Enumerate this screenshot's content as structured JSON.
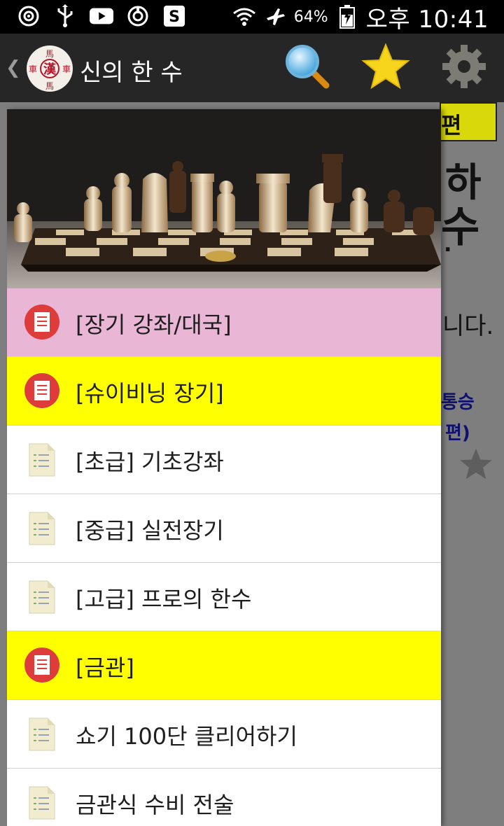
{
  "status_bar": {
    "battery": "64%",
    "time": "오후 10:41",
    "icons": [
      "target-icon",
      "usb-icon",
      "youtube-icon",
      "refresh-icon",
      "s-app-icon",
      "wifi-icon",
      "airplane-icon",
      "battery-icon"
    ]
  },
  "action_bar": {
    "title": "신의 한 수",
    "icons": [
      "back-chevron-icon",
      "app-logo",
      "search-icon",
      "star-icon",
      "gear-icon"
    ]
  },
  "background": {
    "fragment_top": "편",
    "fragment_big1": "하",
    "fragment_big2": "수",
    "fragment_dot": ".",
    "fragment_text": "니다.",
    "fragment_blue1": "통승",
    "fragment_blue2": "편)"
  },
  "drawer": {
    "header_image": "chess-board-photo",
    "items": [
      {
        "label": "[장기 강좌/대국]",
        "style": "pink",
        "icon": "red-document-icon"
      },
      {
        "label": "[슈이비닝 장기]",
        "style": "yellow",
        "icon": "red-document-icon"
      },
      {
        "label": "[초급] 기초강좌",
        "style": "white",
        "icon": "document-icon"
      },
      {
        "label": "[중급] 실전장기",
        "style": "white",
        "icon": "document-icon"
      },
      {
        "label": "[고급] 프로의 한수",
        "style": "white",
        "icon": "document-icon"
      },
      {
        "label": "[금관]",
        "style": "yellow",
        "icon": "red-document-icon"
      },
      {
        "label": "쇼기 100단 클리어하기",
        "style": "white",
        "icon": "document-icon"
      },
      {
        "label": "금관식 수비 전술",
        "style": "white",
        "icon": "document-icon"
      }
    ]
  },
  "colors": {
    "pink": "#eab6d6",
    "yellow": "#ffff00",
    "action_bar": "#262626",
    "star": "#f7d51d"
  }
}
